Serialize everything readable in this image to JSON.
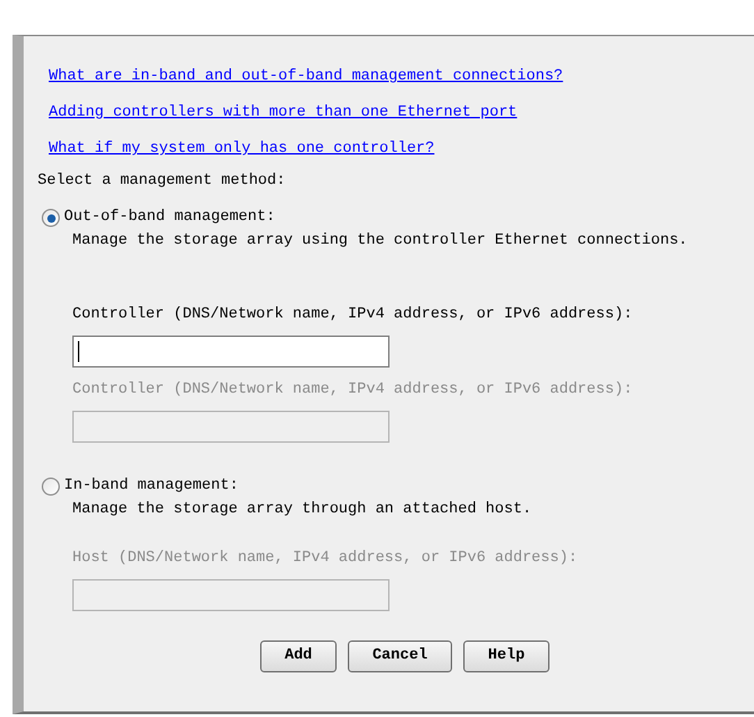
{
  "help_links": [
    "What are in-band and out-of-band management connections?",
    "Adding controllers with more than one Ethernet port",
    "What if my system only has one controller?"
  ],
  "prompt": "Select a management method:",
  "methods": [
    {
      "label": "Out-of-band management:",
      "selected": true,
      "description": "Manage the storage array using the controller Ethernet connections.",
      "fields": [
        {
          "label": "Controller (DNS/Network name, IPv4 address, or IPv6 address):",
          "disabled": false,
          "focused": true
        },
        {
          "label": "Controller (DNS/Network name, IPv4 address, or IPv6 address):",
          "disabled": true,
          "focused": false
        }
      ]
    },
    {
      "label": "In-band management:",
      "selected": false,
      "description": "Manage the storage array through an attached host.",
      "fields": [
        {
          "label": "Host (DNS/Network name, IPv4 address, or IPv6 address):",
          "disabled": true,
          "focused": false
        }
      ]
    }
  ],
  "buttons": [
    "Add",
    "Cancel",
    "Help"
  ]
}
